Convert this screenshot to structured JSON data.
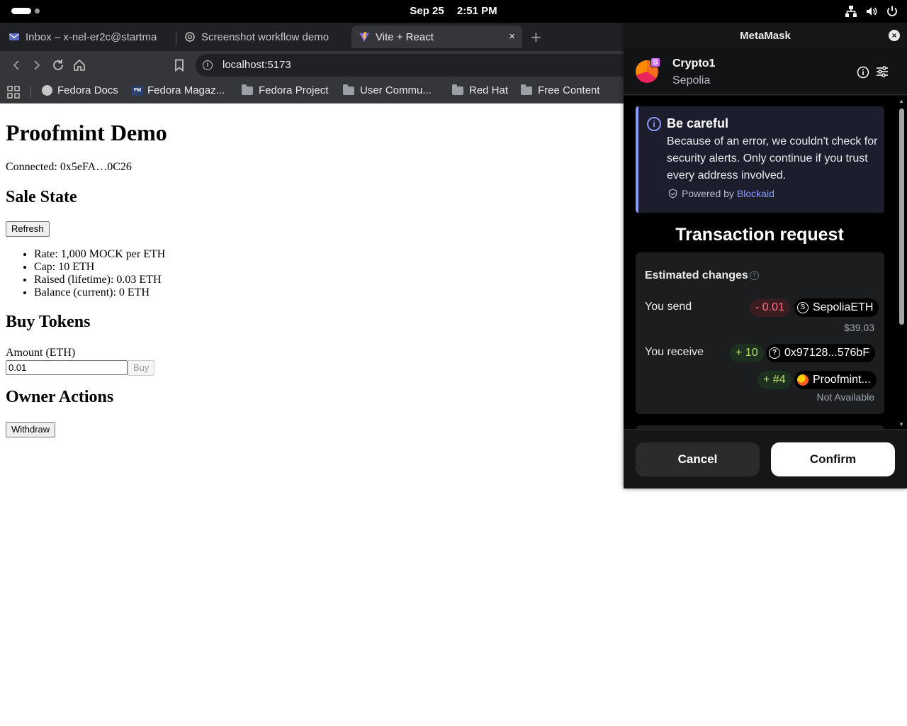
{
  "system_bar": {
    "date": "Sep 25",
    "time": "2:51 PM"
  },
  "browser": {
    "tabs": [
      {
        "label": "Inbox – x-nel-er2c@startma",
        "icon": "mail-icon",
        "active": false
      },
      {
        "label": "Screenshot workflow demo",
        "icon": "openai-icon",
        "active": false
      },
      {
        "label": "Vite + React",
        "icon": "vite-icon",
        "active": true
      }
    ],
    "tab_close_glyph": "×",
    "new_tab_glyph": "+",
    "url": "localhost:5173",
    "bookmarks": [
      {
        "label": "Fedora Docs",
        "icon": "globe-icon"
      },
      {
        "label": "Fedora Magaz...",
        "icon": "fedora-magazine-icon",
        "icon_text": "FM"
      },
      {
        "label": "Fedora Project",
        "icon": "folder-icon"
      },
      {
        "label": "User Commu...",
        "icon": "folder-icon"
      },
      {
        "label": "Red Hat",
        "icon": "folder-icon"
      },
      {
        "label": "Free Content",
        "icon": "folder-icon"
      }
    ]
  },
  "page": {
    "title": "Proofmint Demo",
    "connected": "Connected: 0x5eFA…0C26",
    "sale_state_heading": "Sale State",
    "refresh_label": "Refresh",
    "stats": [
      "Rate: 1,000 MOCK per ETH",
      "Cap: 10 ETH",
      "Raised (lifetime): 0.03 ETH",
      "Balance (current): 0 ETH"
    ],
    "buy_heading": "Buy Tokens",
    "amount_label": "Amount (ETH)",
    "amount_value": "0.01",
    "buy_label": "Buy",
    "owner_heading": "Owner Actions",
    "withdraw_label": "Withdraw"
  },
  "metamask": {
    "window_title": "MetaMask",
    "close_glyph": "×",
    "account_name": "Crypto1",
    "network": "Sepolia",
    "network_badge": "S",
    "alert": {
      "title": "Be careful",
      "body": "Because of an error, we couldn't check for security alerts. Only continue if you trust every address involved.",
      "powered_by": "Powered by",
      "provider": "Blockaid",
      "icon_glyph": "i",
      "accent": "#8b99ff"
    },
    "transaction_title": "Transaction request",
    "estimated_changes_label": "Estimated changes",
    "help_glyph": "?",
    "send": {
      "label": "You send",
      "amount": "- 0.01",
      "token": "SepoliaETH",
      "token_icon_text": "S",
      "fiat": "$39.03"
    },
    "receive": {
      "label": "You receive",
      "items": [
        {
          "amount": "+ 10",
          "token": "0x97128...576bF",
          "token_icon_text": "?"
        },
        {
          "amount": "+ #4",
          "token": "Proofmint...",
          "note": "Not Available"
        }
      ]
    },
    "cancel_label": "Cancel",
    "confirm_label": "Confirm",
    "colors": {
      "negative": "#ff7584",
      "positive": "#b3e06b"
    }
  }
}
